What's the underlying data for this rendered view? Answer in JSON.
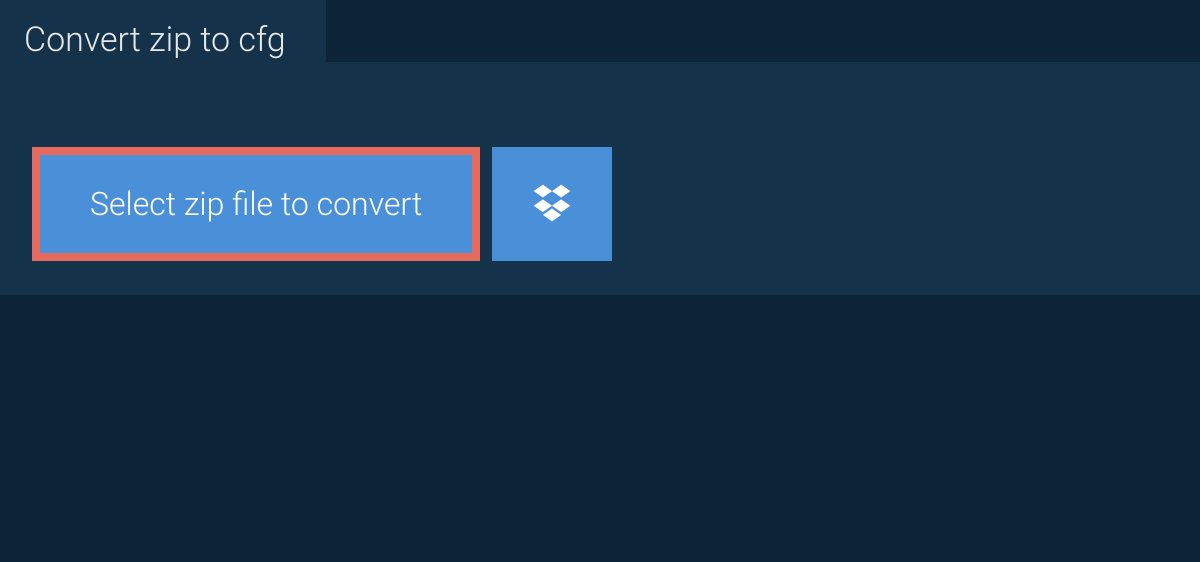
{
  "tab": {
    "title": "Convert zip to cfg"
  },
  "actions": {
    "select_label": "Select zip file to convert"
  },
  "colors": {
    "page_bg": "#0d2438",
    "panel_bg": "#14334a",
    "accent": "#4a90d9",
    "highlight_border": "#e36a5c"
  }
}
